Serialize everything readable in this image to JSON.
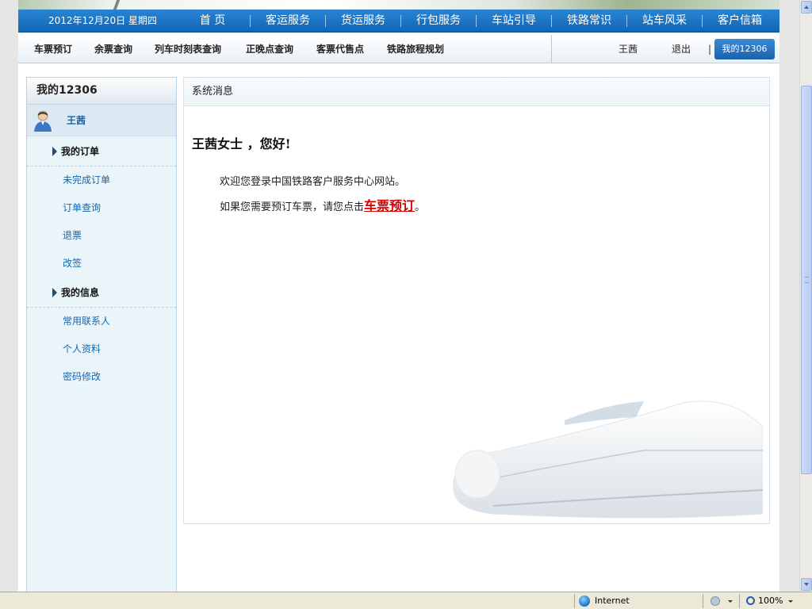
{
  "header": {
    "date": "2012年12月20日  星期四",
    "nav": [
      "首  页",
      "客运服务",
      "货运服务",
      "行包服务",
      "车站引导",
      "铁路常识",
      "站车风采",
      "客户信箱"
    ]
  },
  "subnav": {
    "items": [
      "车票预订",
      "余票查询",
      "列车时刻表查询",
      "正晚点查询",
      "客票代售点",
      "铁路旅程规划"
    ],
    "user": "王茜",
    "logout": "退出",
    "pipe": "|",
    "my_label": "我的12306"
  },
  "sidebar": {
    "title": "我的12306",
    "user": "王茜",
    "orders_title": "我的订单",
    "orders": [
      "未完成订单",
      "订单查询",
      "退票",
      "改签"
    ],
    "info_title": "我的信息",
    "info": [
      "常用联系人",
      "个人资料",
      "密码修改"
    ]
  },
  "main": {
    "panel_title": "系统消息",
    "greeting": "王茜女士 ，您好!",
    "line1": "欢迎您登录中国铁路客户服务中心网站。",
    "line2_prefix": "如果您需要预订车票，请您点击",
    "book_link": "车票预订",
    "line2_suffix": "。"
  },
  "status": {
    "zone": "Internet",
    "zoom": "100%"
  }
}
